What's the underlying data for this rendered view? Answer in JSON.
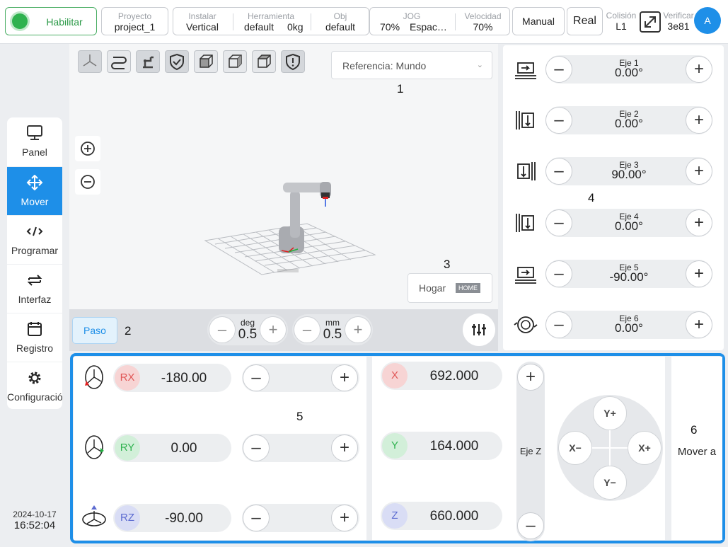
{
  "topbar": {
    "enable": "Habilitar",
    "project": {
      "label": "Proyecto",
      "value": "project_1"
    },
    "install": {
      "label": "Instalar",
      "value": "Vertical"
    },
    "tool": {
      "label": "Herramienta",
      "value": "default",
      "value2": "0kg"
    },
    "obj": {
      "label": "Obj",
      "value": "default"
    },
    "jog": {
      "label": "JOG",
      "value": "70%",
      "value2": "Espac…"
    },
    "speed": {
      "label": "Velocidad",
      "value": "70%"
    },
    "manual": "Manual",
    "real": "Real",
    "collision": {
      "label": "Colisión",
      "value": "L1"
    },
    "verify": {
      "label": "Verificar",
      "value": "3e81"
    },
    "avatar": "A"
  },
  "nav": {
    "items": [
      {
        "label": "Panel",
        "icon": "monitor-icon"
      },
      {
        "label": "Mover",
        "icon": "move-icon"
      },
      {
        "label": "Programar",
        "icon": "code-icon"
      },
      {
        "label": "Interfaz",
        "icon": "swap-icon"
      },
      {
        "label": "Registro",
        "icon": "calendar-icon"
      },
      {
        "label": "Configuración",
        "icon": "gear-icon"
      }
    ],
    "active_index": 1,
    "date": "2024-10-17",
    "time": "16:52:04"
  },
  "viewport": {
    "reference": "Referencia: Mundo",
    "home": "Hogar",
    "home_tag": "HOME"
  },
  "step": {
    "mode": "Paso",
    "angle": {
      "unit": "deg",
      "value": "0.5"
    },
    "distance": {
      "unit": "mm",
      "value": "0.5"
    }
  },
  "joints": [
    {
      "name": "Eje 1",
      "value": "0.00°"
    },
    {
      "name": "Eje 2",
      "value": "0.00°"
    },
    {
      "name": "Eje 3",
      "value": "90.00°"
    },
    {
      "name": "Eje 4",
      "value": "0.00°"
    },
    {
      "name": "Eje 5",
      "value": "-90.00°"
    },
    {
      "name": "Eje 6",
      "value": "0.00°"
    }
  ],
  "rotation": [
    {
      "axis": "RX",
      "value": "-180.00"
    },
    {
      "axis": "RY",
      "value": "0.00"
    },
    {
      "axis": "RZ",
      "value": "-90.00"
    }
  ],
  "position": [
    {
      "axis": "X",
      "value": "692.000"
    },
    {
      "axis": "Y",
      "value": "164.000"
    },
    {
      "axis": "Z",
      "value": "660.000"
    }
  ],
  "z_axis_label": "Eje Z",
  "dpad": {
    "up": "Y+",
    "down": "Y−",
    "left": "X−",
    "right": "X+"
  },
  "move_to": "Mover a",
  "markers": [
    "1",
    "2",
    "3",
    "4",
    "5",
    "6"
  ],
  "colors": {
    "accent": "#1e8fe8",
    "enable": "#2fb24f",
    "rx": "#e05555",
    "ry": "#2fb24f",
    "rz": "#5b6ad0"
  }
}
